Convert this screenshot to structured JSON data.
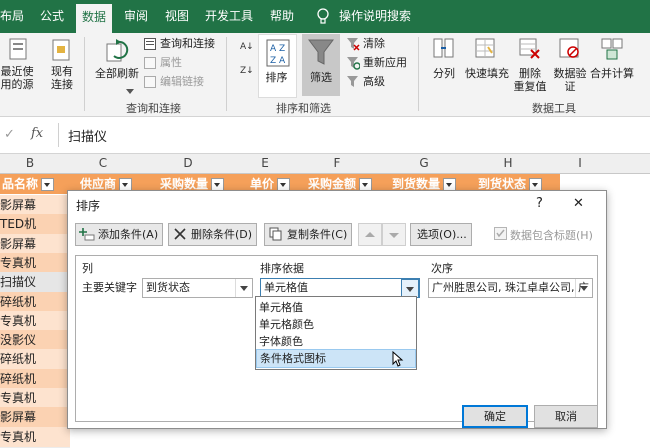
{
  "tabs": [
    "布局",
    "公式",
    "数据",
    "审阅",
    "视图",
    "开发工具",
    "帮助",
    "操作说明搜索"
  ],
  "ribbon": {
    "recent_sources": "最近使\n用的源",
    "existing_connections": "现有\n连接",
    "refresh_all": "全部刷新",
    "queries_connections": "查询和连接",
    "properties": "属性",
    "edit_links": "编辑链接",
    "group_queries": "查询和连接",
    "sort": "排序",
    "filter": "筛选",
    "clear": "清除",
    "reapply": "重新应用",
    "advanced": "高级",
    "group_sort_filter": "排序和筛选",
    "text_to_columns": "分列",
    "flash_fill": "快速填充",
    "remove_duplicates": "删除\n重复值",
    "data_validation": "数据验\n证",
    "consolidate": "合并计算",
    "group_data_tools": "数据工具"
  },
  "formula_bar": {
    "fx": "fx",
    "value": "扫描仪"
  },
  "columns": [
    "B",
    "C",
    "D",
    "E",
    "F",
    "G",
    "H",
    "I"
  ],
  "header_row": [
    "品名称",
    "供应商",
    "采购数量",
    "单价",
    "采购金额",
    "到货数量",
    "到货状态"
  ],
  "rows": [
    "影屏幕",
    "TED机",
    "影屏幕",
    "专真机",
    "扫描仪",
    "碎纸机",
    "专真机",
    "没影仪",
    "碎纸机",
    "碎纸机",
    "专真机",
    "影屏幕",
    "专真机"
  ],
  "dialog": {
    "title": "排序",
    "help": "?",
    "close": "✕",
    "add_level": "添加条件(A)",
    "delete_level": "删除条件(D)",
    "copy_level": "复制条件(C)",
    "options": "选项(O)...",
    "header_checkbox": "数据包含标题(H)",
    "col_label": "列",
    "sort_on_label": "排序依据",
    "order_label": "次序",
    "row_label": "主要关键字",
    "column_value": "到货状态",
    "sort_on_value": "单元格值",
    "order_value": "广州胜思公司, 珠江卓卓公司, 广",
    "sort_on_options": [
      "单元格值",
      "单元格颜色",
      "字体颜色",
      "条件格式图标"
    ],
    "ok": "确定",
    "cancel": "取消"
  },
  "colors": {
    "accent": "#217346",
    "header_fill": "#f5a05a",
    "selection": "#cce4f7"
  }
}
